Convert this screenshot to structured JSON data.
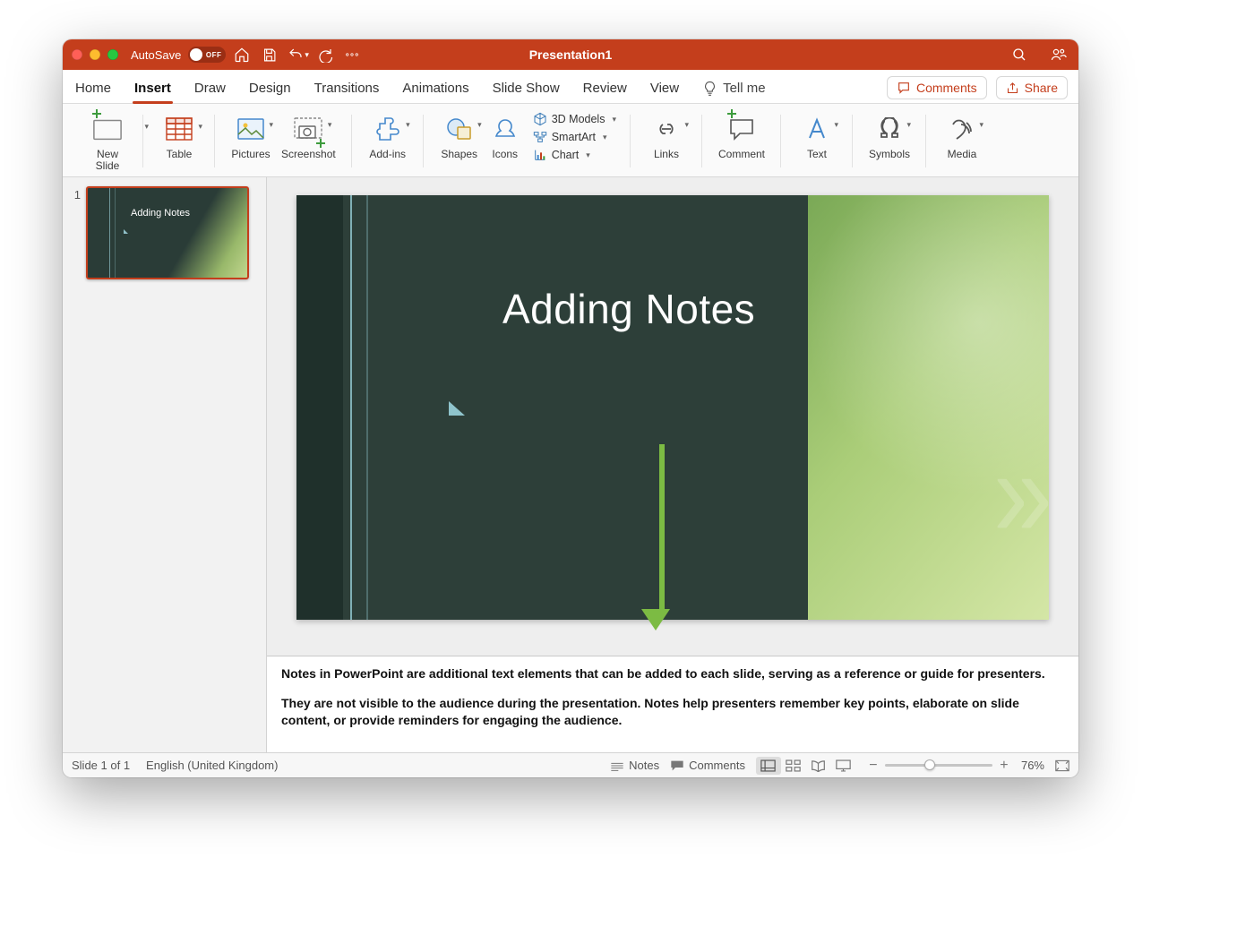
{
  "titlebar": {
    "autosave_label": "AutoSave",
    "autosave_state": "OFF",
    "title": "Presentation1"
  },
  "tabs": {
    "items": [
      "Home",
      "Insert",
      "Draw",
      "Design",
      "Transitions",
      "Animations",
      "Slide Show",
      "Review",
      "View"
    ],
    "active": "Insert",
    "tellme": "Tell me",
    "comments": "Comments",
    "share": "Share"
  },
  "ribbon": {
    "new_slide": "New\nSlide",
    "table": "Table",
    "pictures": "Pictures",
    "screenshot": "Screenshot",
    "addins": "Add-ins",
    "shapes": "Shapes",
    "icons": "Icons",
    "models3d": "3D Models",
    "smartart": "SmartArt",
    "chart": "Chart",
    "links": "Links",
    "comment": "Comment",
    "text": "Text",
    "symbols": "Symbols",
    "media": "Media"
  },
  "thumbs": {
    "items": [
      {
        "num": "1",
        "title": "Adding Notes"
      }
    ]
  },
  "slide": {
    "title": "Adding Notes"
  },
  "notes": {
    "p1": "Notes in PowerPoint are additional text elements that can be added to each slide, serving as a reference or guide for presenters.",
    "p2": "They are not visible to the audience during the presentation. Notes help presenters remember key points, elaborate on slide content, or provide reminders for engaging the audience."
  },
  "status": {
    "slide_info": "Slide 1 of 1",
    "language": "English (United Kingdom)",
    "notes_btn": "Notes",
    "comments_btn": "Comments",
    "zoom_pct": "76%"
  }
}
